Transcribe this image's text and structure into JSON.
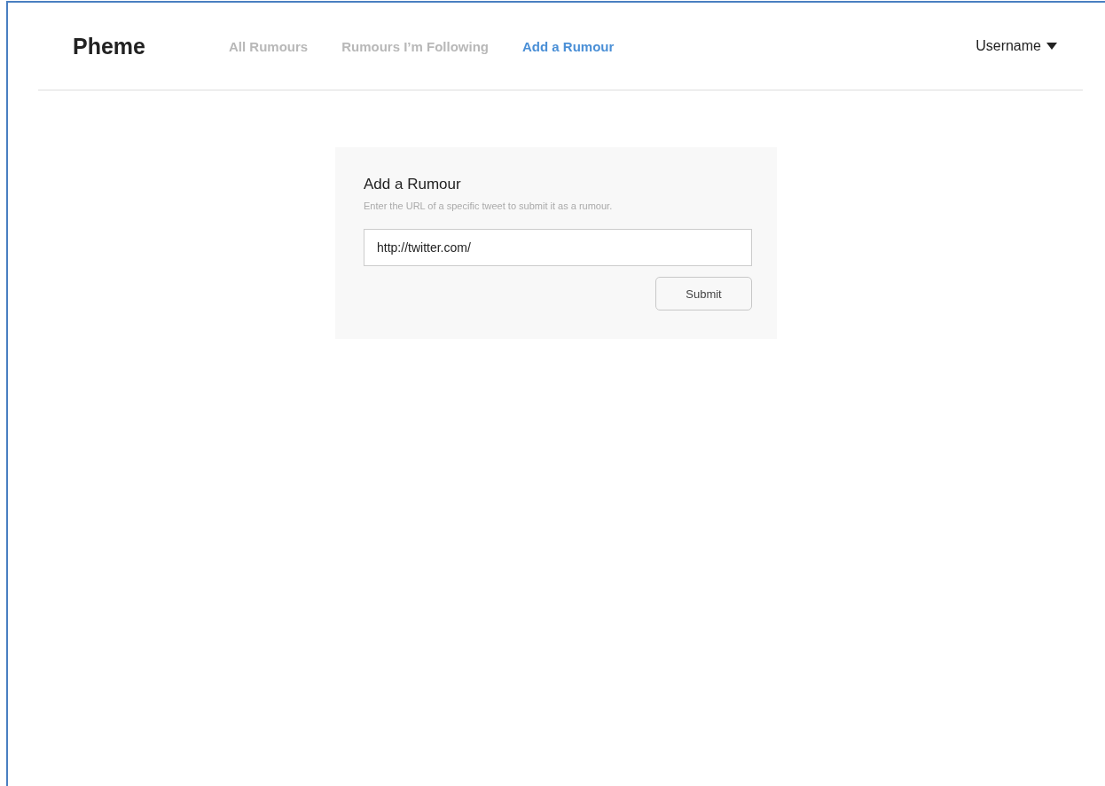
{
  "brand": "Pheme",
  "nav": [
    {
      "label": "All Rumours",
      "selected": false
    },
    {
      "label": "Rumours I’m Following",
      "selected": false
    },
    {
      "label": "Add a Rumour",
      "selected": true
    }
  ],
  "user_menu": {
    "label": "Username"
  },
  "form": {
    "title": "Add a Rumour",
    "hint": "Enter the URL of a specific tweet to submit it as a rumour.",
    "url_value": "http://twitter.com/",
    "submit": "Submit"
  }
}
